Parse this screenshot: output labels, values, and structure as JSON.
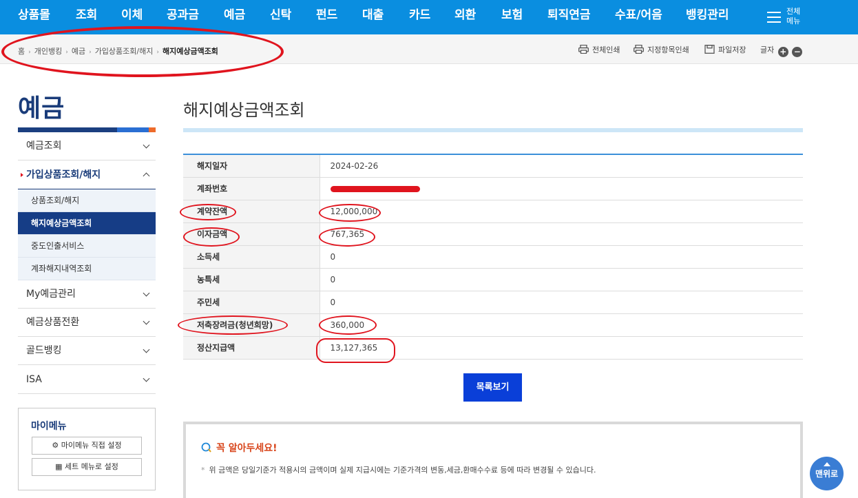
{
  "topnav": {
    "items": [
      "상품몰",
      "조회",
      "이체",
      "공과금",
      "예금",
      "신탁",
      "펀드",
      "대출",
      "카드",
      "외환",
      "보험",
      "퇴직연금",
      "수표/어음",
      "뱅킹관리"
    ],
    "all_menu": [
      "전체",
      "메뉴"
    ]
  },
  "breadcrumb": {
    "items": [
      "홈",
      "개인뱅킹",
      "예금",
      "가입상품조회/해지"
    ],
    "current": "해지예상금액조회"
  },
  "tools": {
    "print_all": "전체인쇄",
    "print_selected": "지정항목인쇄",
    "save_file": "파일저장",
    "font_size": "글자",
    "plus": "+",
    "minus": "−"
  },
  "sidebar": {
    "title": "예금",
    "items": [
      {
        "label": "예금조회"
      },
      {
        "label": "가입상품조회/해지"
      },
      {
        "label": "My예금관리"
      },
      {
        "label": "예금상품전환"
      },
      {
        "label": "골드뱅킹"
      },
      {
        "label": "ISA"
      }
    ],
    "subitems": [
      "상품조회/해지",
      "해지예상금액조회",
      "중도인출서비스",
      "계좌해지내역조회"
    ],
    "mymenu": {
      "title": "마이메뉴",
      "direct_setting": "마이메뉴 직접 설정",
      "set_setting": "세트 메뉴로 설정"
    }
  },
  "main": {
    "title": "해지예상금액조회",
    "rows": [
      {
        "label": "해지일자",
        "value": "2024-02-26"
      },
      {
        "label": "계좌번호",
        "value": ""
      },
      {
        "label": "계약잔액",
        "value": "12,000,000"
      },
      {
        "label": "이자금액",
        "value": "767,365"
      },
      {
        "label": "소득세",
        "value": "0"
      },
      {
        "label": "농특세",
        "value": "0"
      },
      {
        "label": "주민세",
        "value": "0"
      },
      {
        "label": "저축장려금(청년희망)",
        "value": "360,000"
      },
      {
        "label": "정산지급액",
        "value": "13,127,365"
      }
    ],
    "list_button": "목록보기"
  },
  "notice": {
    "title": "꼭 알아두세요!",
    "text": "위 금액은 당일기준가 적용시의 금액이며 실제 지급시에는 기준가격의 변동,세금,환매수수료 등에 따라 변경될 수 있습니다."
  },
  "top_button": "맨위로",
  "colors": {
    "nav": "#0a8ee0",
    "brand_dark": "#1a3c7a",
    "annotation": "#e0141e",
    "button": "#0a3fd8"
  }
}
